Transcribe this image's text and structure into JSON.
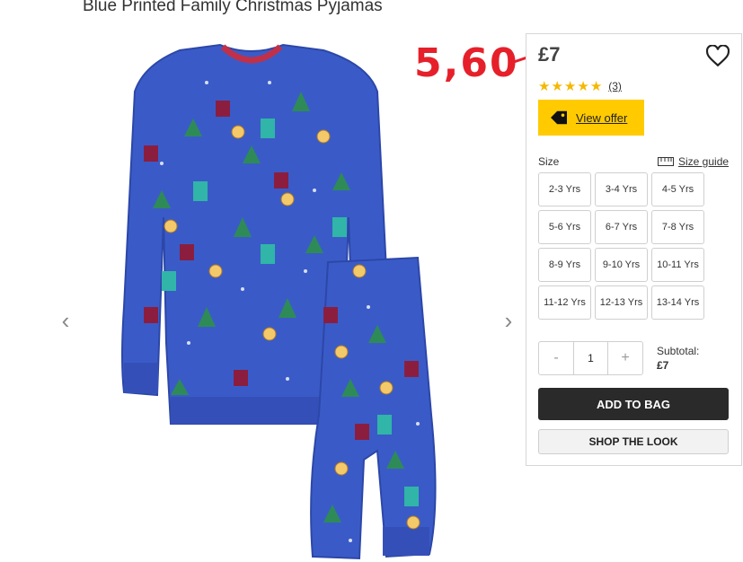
{
  "product": {
    "title": "Blue Printed Family Christmas Pyjamas"
  },
  "gallery": {
    "prev_icon": "chevron-left-icon",
    "next_icon": "chevron-right-icon",
    "prev_glyph": "‹",
    "next_glyph": "›"
  },
  "pricing": {
    "price": "£7",
    "annotated_price": "5,60",
    "annotation_color": "#e6202a"
  },
  "rating": {
    "stars": 5,
    "star_glyph": "★",
    "reviews_count": "(3)",
    "star_color": "#f5b800"
  },
  "offer": {
    "label": "View offer",
    "icon": "tag-icon",
    "color": "#ffcb00"
  },
  "size": {
    "label": "Size",
    "guide_label": "Size guide",
    "guide_icon": "ruler-icon",
    "options": [
      "2-3 Yrs",
      "3-4 Yrs",
      "4-5 Yrs",
      "5-6 Yrs",
      "6-7 Yrs",
      "7-8 Yrs",
      "8-9 Yrs",
      "9-10 Yrs",
      "10-11 Yrs",
      "11-12 Yrs",
      "12-13 Yrs",
      "13-14 Yrs"
    ]
  },
  "quantity": {
    "minus": "-",
    "value": "1",
    "plus": "+"
  },
  "subtotal": {
    "label": "Subtotal:",
    "value": "£7"
  },
  "actions": {
    "add_to_bag": "ADD TO BAG",
    "shop_the_look": "SHOP THE LOOK"
  },
  "icons": {
    "wishlist": "heart-icon"
  },
  "colors": {
    "pyjama_blue": "#3a5bc7",
    "button_dark": "#2a2a2a"
  }
}
